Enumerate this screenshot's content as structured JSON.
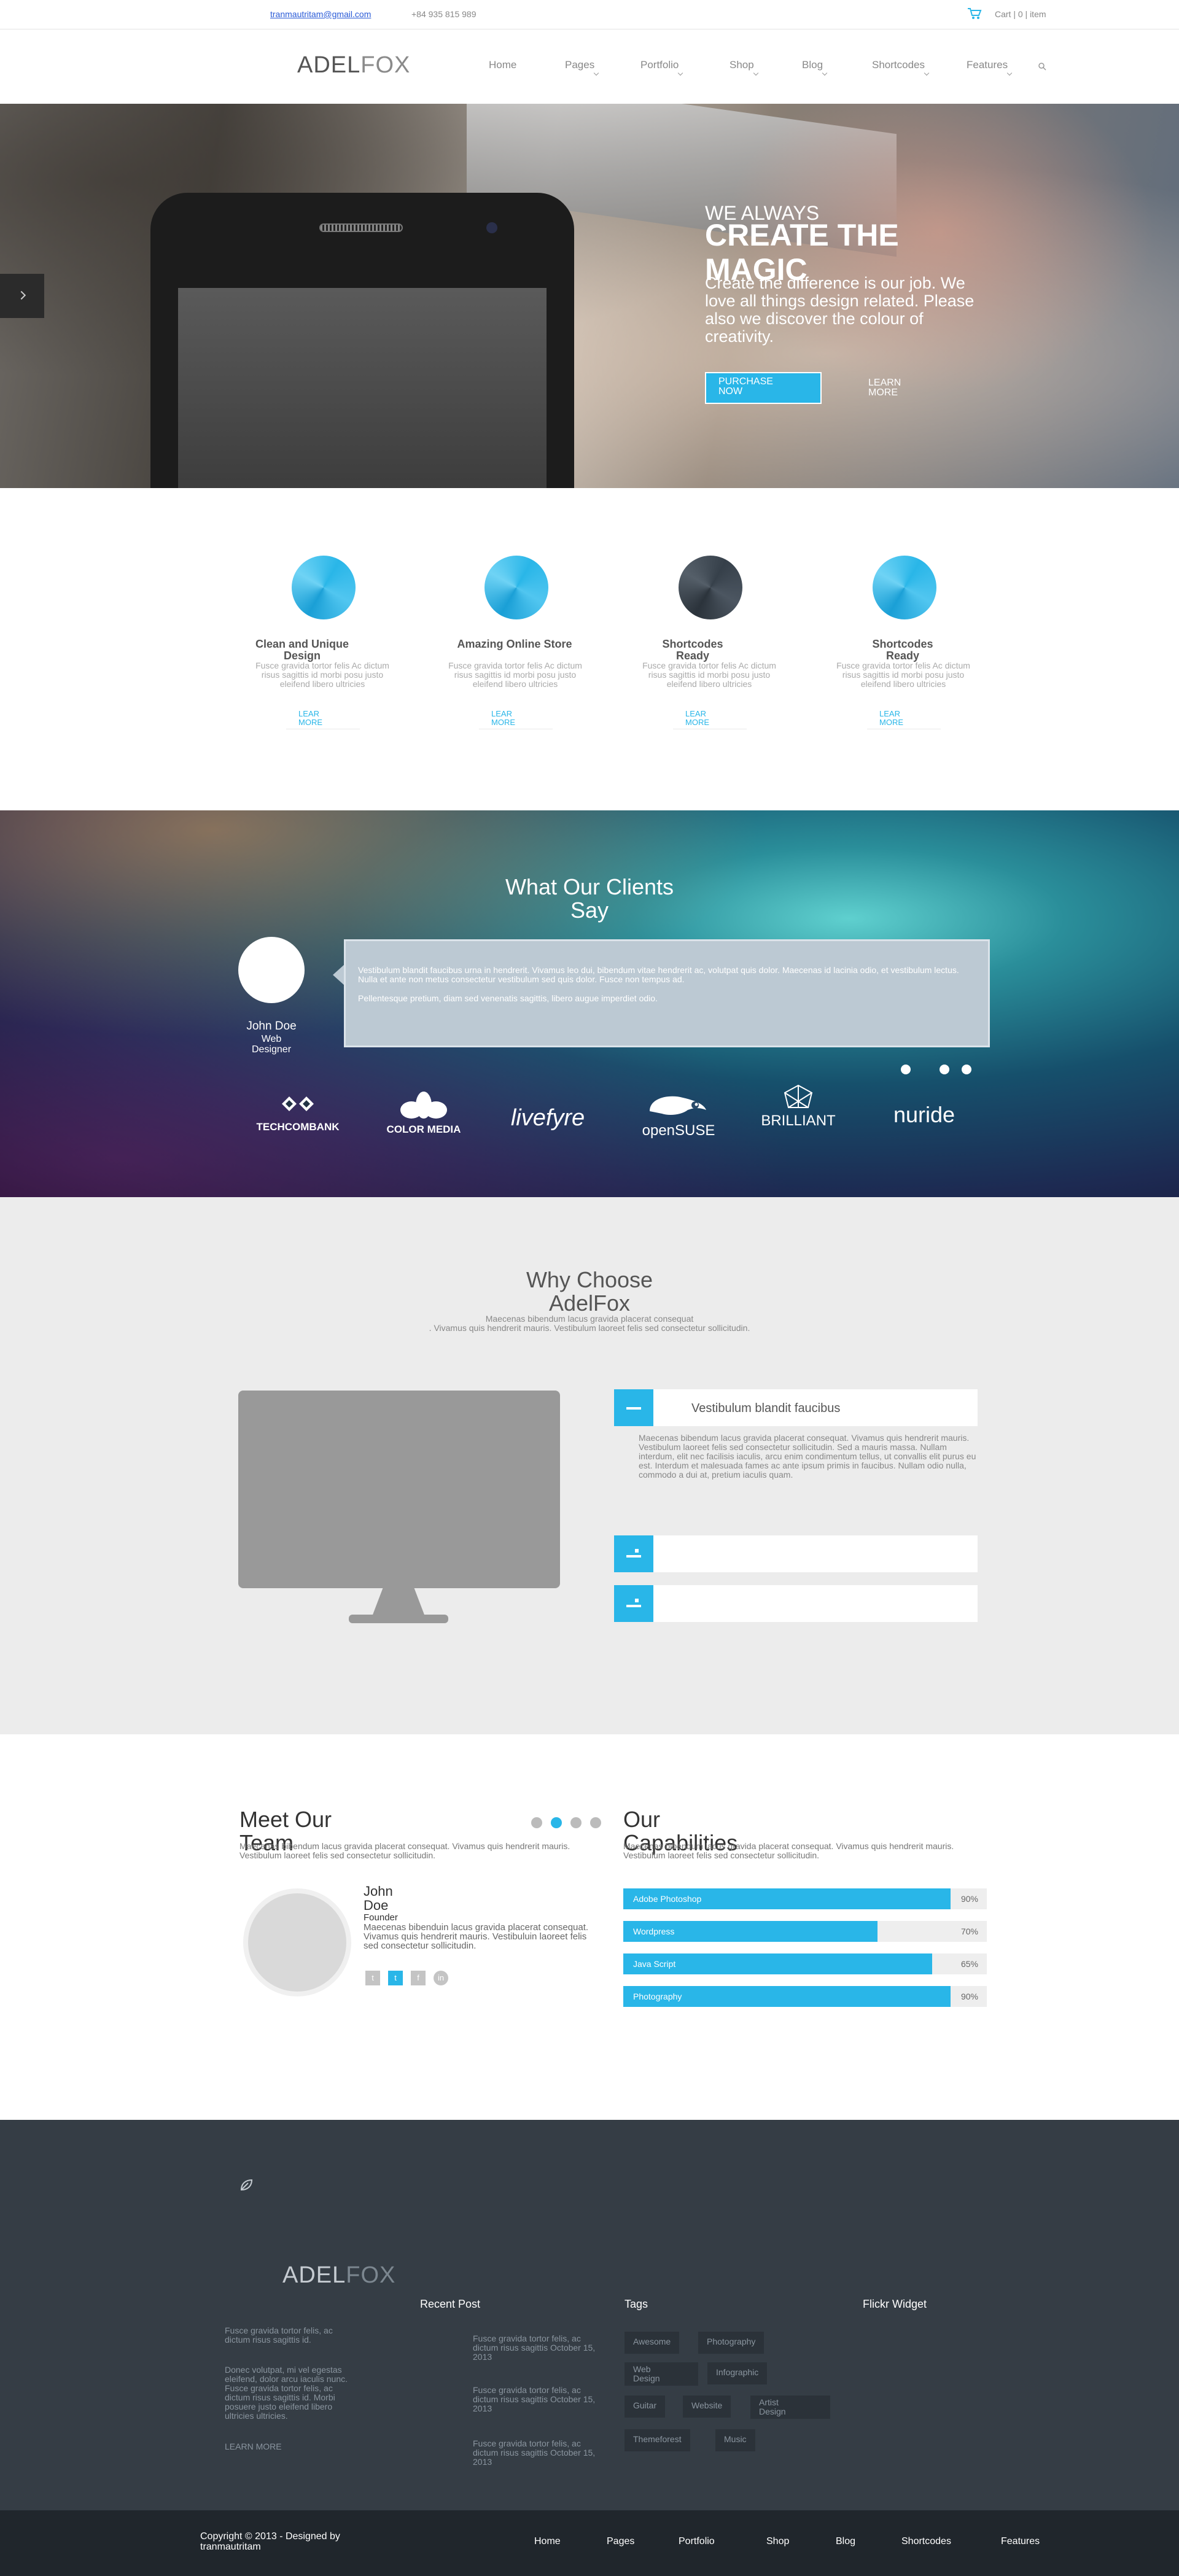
{
  "topbar": {
    "email": "tranmautritam@gmail.com",
    "phone": "+84 935 815 989",
    "cart": "Cart | 0 | item"
  },
  "header": {
    "logo_a": "ADEL",
    "logo_b": "FOX",
    "nav": [
      "Home",
      "Pages",
      "Portfolio",
      "Shop",
      "Blog",
      "Shortcodes",
      "Features"
    ]
  },
  "hero": {
    "small": "WE ALWAYS",
    "big": "CREATE THE MAGIC",
    "desc": "Create the difference is our job. We love all things design related. Please also we discover the colour of creativity.",
    "btn_purchase": "PURCHASE NOW",
    "btn_learn": "LEARN MORE"
  },
  "features": [
    {
      "title": "Clean and Unique Design",
      "desc": "Fusce gravida tortor felis Ac dictum risus sagittis id morbi posu justo eleifend libero ultricies",
      "link": "LEAR MORE",
      "color": "blue"
    },
    {
      "title": "Amazing Online Store",
      "desc": "Fusce gravida tortor felis Ac dictum risus sagittis id morbi posu justo eleifend libero ultricies",
      "link": "LEAR MORE",
      "color": "blue"
    },
    {
      "title": "Shortcodes Ready",
      "desc": "Fusce gravida tortor felis Ac dictum risus sagittis id morbi posu justo eleifend libero ultricies",
      "link": "LEAR MORE",
      "color": "dark"
    },
    {
      "title": "Shortcodes Ready",
      "desc": "Fusce gravida tortor felis Ac dictum risus sagittis id morbi posu justo eleifend libero ultricies",
      "link": "LEAR MORE",
      "color": "blue"
    }
  ],
  "clients": {
    "title": "What Our Clients Say",
    "person_name": "John Doe",
    "person_role": "Web Designer",
    "quote_1": "Vestibulum blandit faucibus urna in hendrerit. Vivamus leo dui, bibendum vitae hendrerit ac, volutpat quis dolor. Maecenas id lacinia odio, et vestibulum lectus. Nulla et ante non metus consectetur vestibulum sed quis dolor. Fusce non tempus ad.",
    "quote_2": "Pellentesque pretium, diam sed venenatis sagittis, libero augue imperdiet odio.",
    "brands": [
      "TECHCOMBANK",
      "COLOR MEDIA",
      "livefyre",
      "openSUSE",
      "BRILLIANT",
      "nuride"
    ]
  },
  "why": {
    "title": "Why Choose AdelFox",
    "sub_1": "Maecenas bibendum lacus gravida placerat consequat",
    "sub_2": ". Vivamus quis hendrerit mauris. Vestibulum laoreet felis sed consectetur sollicitudin.",
    "acc_1": "Vestibulum blandit faucibus",
    "acc_body": "Maecenas bibendum lacus gravida placerat consequat. Vivamus quis hendrerit mauris. Vestibulum laoreet felis sed consectetur sollicitudin. Sed a mauris massa. Nullam interdum, elit nec facilisis iaculis, arcu enim condimentum tellus, ut convallis elit purus eu est. Interdum et malesuada fames ac ante ipsum primis in faucibus. Nullam odio nulla, commodo a dui at, pretium iaculis quam."
  },
  "team": {
    "title": "Meet Our Team",
    "sub": "Maecenas bibendum lacus gravida placerat consequat. Vivamus quis hendrerit mauris. Vestibulum laoreet felis sed consectetur sollicitudin.",
    "name": "John Doe",
    "role": "Founder",
    "desc": "Maecenas bibenduin lacus gravida placerat consequat. Vivamus quis hendrerit mauris. Vestibuluin laoreet felis sed consectetur sollicitudin.",
    "social": [
      "t",
      "t",
      "f",
      "in"
    ]
  },
  "capabilities": {
    "title": "Our Capabilities",
    "sub": "Maecenas bibendum lacus gravida placerat consequat. Vivamus quis hendrerit mauris. Vestibulum laoreet felis sed consectetur sollicitudin.",
    "skills": [
      {
        "label": "Adobe Photoshop",
        "pct": "90%",
        "level": 0.9
      },
      {
        "label": "Wordpress",
        "pct": "70%",
        "level": 0.7
      },
      {
        "label": "Java Script",
        "pct": "65%",
        "level": 0.85
      },
      {
        "label": "Photography",
        "pct": "90%",
        "level": 0.9
      }
    ]
  },
  "footer": {
    "logo_a": "ADEL",
    "logo_b": "FOX",
    "about_1": "Fusce gravida tortor felis, ac dictum risus sagittis id.",
    "about_2": "Donec volutpat, mi vel egestas eleifend, dolor arcu iaculis nunc. Fusce gravida tortor felis, ac dictum risus sagittis id. Morbi posuere justo eleifend libero ultricies ultricies.",
    "learn_more": "LEARN MORE",
    "recent_title": "Recent Post",
    "recent": [
      "Fusce gravida tortor felis, ac dictum risus sagittis October 15, 2013",
      "Fusce gravida tortor felis, ac dictum risus sagittis October 15, 2013",
      "Fusce gravida tortor felis, ac dictum risus sagittis October 15, 2013"
    ],
    "tags_title": "Tags",
    "tags": [
      "Awesome",
      "Photography",
      "Web Design",
      "Infographic",
      "Guitar",
      "Website",
      "Artist Design",
      "Themeforest",
      "Music"
    ],
    "flickr_title": "Flickr Widget"
  },
  "bottom": {
    "copyright": "Copyright © 2013 - Designed by tranmautritam",
    "nav": [
      "Home",
      "Pages",
      "Portfolio",
      "Shop",
      "Blog",
      "Shortcodes",
      "Features"
    ]
  },
  "colors": {
    "accent": "#29b6e8",
    "footer_bg": "#353d45",
    "bottom_bg": "#20262c"
  }
}
